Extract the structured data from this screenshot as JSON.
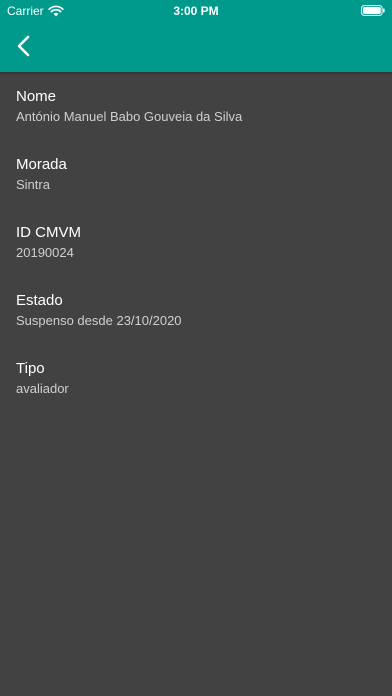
{
  "status_bar": {
    "carrier": "Carrier",
    "time": "3:00 PM",
    "icons": [
      "wifi-icon",
      "battery-icon"
    ]
  },
  "app_bar": {
    "color": "#009a8c",
    "back_icon": "chevron-left-icon"
  },
  "background_color": "#424242",
  "fields": [
    {
      "label": "Nome",
      "value": "António Manuel Babo Gouveia da Silva"
    },
    {
      "label": "Morada",
      "value": "Sintra"
    },
    {
      "label": "ID CMVM",
      "value": "20190024"
    },
    {
      "label": "Estado",
      "value": "Suspenso desde 23/10/2020"
    },
    {
      "label": "Tipo",
      "value": "avaliador"
    }
  ]
}
